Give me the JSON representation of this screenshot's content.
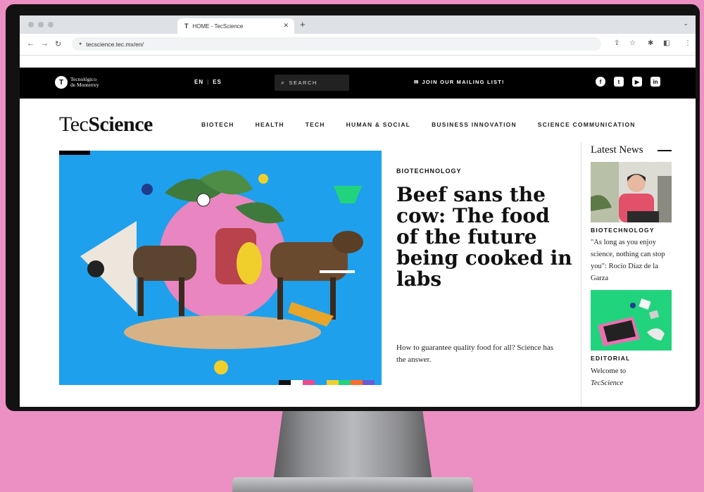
{
  "browser": {
    "tab_title": "HOME - TecScience",
    "favicon": "T",
    "url": "tecscience.tec.mx/en/"
  },
  "topbar": {
    "logo_line1": "Tecnológico",
    "logo_line2": "de Monterrey",
    "lang_en": "EN",
    "lang_sep": "|",
    "lang_es": "ES",
    "search_placeholder": "SEARCH",
    "mailing": "JOIN OUR MAILING LIST!"
  },
  "site": {
    "brand_light": "Tec",
    "brand_bold": "Science",
    "nav": [
      "BIOTECH",
      "HEALTH",
      "TECH",
      "HUMAN & SOCIAL",
      "BUSINESS INNOVATION",
      "SCIENCE COMMUNICATION"
    ]
  },
  "hero": {
    "kicker": "BIOTECHNOLOGY",
    "headline": "Beef sans the cow: The food of the future being cooked in labs",
    "dek": "How to guarantee quality food for all? Science has the answer."
  },
  "sidebar": {
    "heading": "Latest News",
    "cards": [
      {
        "kicker": "BIOTECHNOLOGY",
        "title": "\"As long as you enjoy science, nothing can stop you\": Rocío Díaz de la Garza"
      },
      {
        "kicker": "EDITORIAL",
        "title_prefix": "Welcome to",
        "title_em": "TecScience"
      }
    ]
  },
  "colors": {
    "accent_pink": "#ec8fc2",
    "hero_blue": "#1fa0ec",
    "editorial_green": "#22d37d"
  },
  "icons": [
    "back-icon",
    "forward-icon",
    "reload-icon",
    "lock-icon",
    "share-icon",
    "star-icon",
    "extensions-icon",
    "sidebar-icon",
    "kebab-menu-icon",
    "search-icon",
    "mail-icon",
    "facebook-icon",
    "twitter-icon",
    "youtube-icon",
    "linkedin-icon"
  ]
}
